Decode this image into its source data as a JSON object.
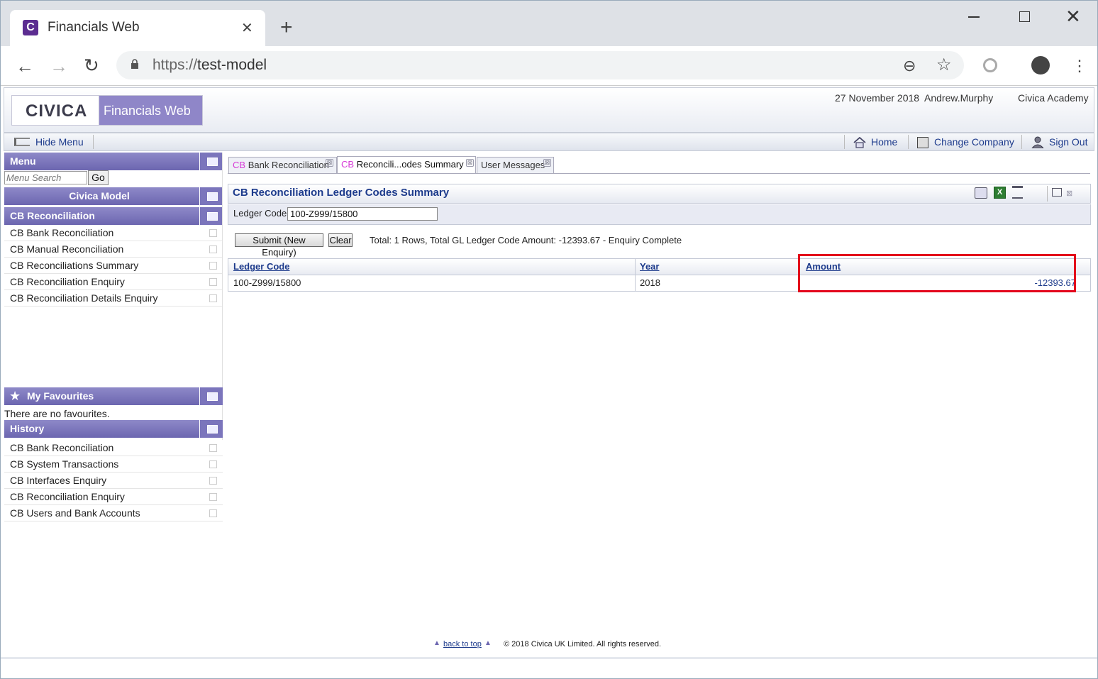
{
  "browser": {
    "tab_title": "Financials Web",
    "favicon_letter": "C",
    "url_scheme": "https://",
    "url_host": "test-model",
    "tab_close_glyph": "✕",
    "new_tab_glyph": "+",
    "icons": [
      "back-icon",
      "forward-icon",
      "reload-icon",
      "lock-icon",
      "zoom-out-icon",
      "star-icon",
      "extension-icon",
      "profile-icon",
      "kebab-menu-icon"
    ]
  },
  "header": {
    "logo_text": "CIVICA",
    "product_name": "Financials Web",
    "date": "27 November 2018",
    "user": "Andrew.Murphy",
    "company": "Civica Academy",
    "brand_color": "#8f86c8"
  },
  "navbar": {
    "hide_menu": "Hide Menu",
    "home": "Home",
    "change_company": "Change Company",
    "sign_out": "Sign Out"
  },
  "sidebar": {
    "menu_title": "Menu",
    "search_placeholder": "Menu Search",
    "go_label": "Go",
    "model_title": "Civica Model",
    "section_title": "CB Reconciliation",
    "items": [
      {
        "label": "CB Bank Reconciliation"
      },
      {
        "label": "CB Manual Reconciliation"
      },
      {
        "label": "CB Reconciliations Summary"
      },
      {
        "label": "CB Reconciliation Enquiry"
      },
      {
        "label": "CB Reconciliation Details Enquiry"
      }
    ],
    "favourites_title": "My Favourites",
    "favourites_empty": "There are no favourites.",
    "history_title": "History",
    "history": [
      {
        "label": "CB Bank Reconciliation"
      },
      {
        "label": "CB System Transactions"
      },
      {
        "label": "CB Interfaces Enquiry"
      },
      {
        "label": "CB Reconciliation Enquiry"
      },
      {
        "label": "CB Users and Bank Accounts"
      }
    ]
  },
  "content_tabs": [
    {
      "prefix": "CB",
      "label": "Bank Reconciliation"
    },
    {
      "prefix": "CB",
      "label": "Reconcili...odes Summary"
    },
    {
      "prefix": "",
      "label": "User Messages"
    }
  ],
  "panel": {
    "title": "CB Reconciliation Ledger Codes Summary",
    "excel_glyph": "X",
    "close_glyph": "⊠",
    "ledger_label": "Ledger Code",
    "ledger_value": "100-Z999/15800",
    "submit_label": "Submit (New Enquiry)",
    "clear_label": "Clear",
    "status": "Total: 1 Rows, Total GL Ledger Code Amount: -12393.67 - Enquiry Complete"
  },
  "table": {
    "headers": [
      "Ledger Code",
      "Year",
      "Amount"
    ],
    "rows": [
      [
        "100-Z999/15800",
        "2018",
        "-12393.67"
      ]
    ],
    "highlight_color": "#e3001b"
  },
  "footer": {
    "back_to_top": "back to top",
    "copyright": "© 2018 Civica UK Limited. All rights reserved."
  }
}
